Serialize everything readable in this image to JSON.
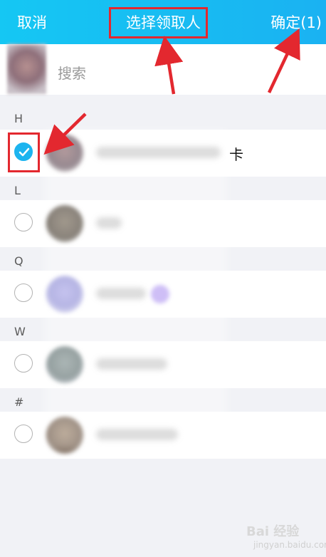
{
  "header": {
    "cancel_label": "取消",
    "title": "选择领取人",
    "confirm_label": "确定(1)"
  },
  "search": {
    "placeholder": "搜索"
  },
  "sections": [
    {
      "letter": "H"
    },
    {
      "letter": "L"
    },
    {
      "letter": "Q"
    },
    {
      "letter": "W"
    },
    {
      "letter": "#"
    }
  ],
  "contacts": [
    {
      "section": "H",
      "selected": true,
      "name_visible_suffix": "卡"
    },
    {
      "section": "L",
      "selected": false
    },
    {
      "section": "Q",
      "selected": false
    },
    {
      "section": "W",
      "selected": false
    },
    {
      "section": "#",
      "selected": false
    }
  ],
  "watermark": {
    "brand": "Bai 经验",
    "sub": "jingyan.baidu.com"
  },
  "colors": {
    "header_gradient_start": "#15c7f3",
    "header_gradient_end": "#1ab2f2",
    "checked": "#1cb4ef",
    "annotation_red": "#e3282f"
  }
}
